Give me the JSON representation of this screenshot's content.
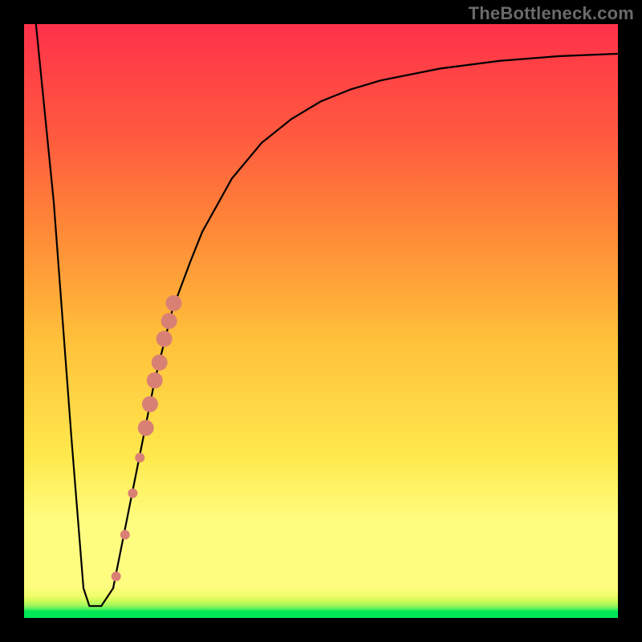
{
  "watermark": "TheBottleneck.com",
  "chart_data": {
    "type": "line",
    "title": "",
    "xlabel": "",
    "ylabel": "",
    "xlim": [
      0,
      100
    ],
    "ylim": [
      0,
      100
    ],
    "series": [
      {
        "name": "bottleneck-curve",
        "x": [
          2,
          5,
          8,
          10,
          11,
          12,
          13,
          15,
          18,
          20,
          22,
          25,
          28,
          30,
          35,
          40,
          45,
          50,
          55,
          60,
          70,
          80,
          90,
          100
        ],
        "y": [
          100,
          70,
          30,
          5,
          2,
          2,
          2,
          5,
          20,
          30,
          40,
          52,
          60,
          65,
          74,
          80,
          84,
          87,
          89,
          90.5,
          92.5,
          93.8,
          94.6,
          95
        ]
      }
    ],
    "markers": {
      "name": "highlighted-points",
      "color": "#d98075",
      "points": [
        {
          "x": 15.5,
          "y": 7,
          "r": 6
        },
        {
          "x": 17.0,
          "y": 14,
          "r": 6
        },
        {
          "x": 18.3,
          "y": 21,
          "r": 6
        },
        {
          "x": 19.5,
          "y": 27,
          "r": 6
        },
        {
          "x": 20.5,
          "y": 32,
          "r": 10
        },
        {
          "x": 21.2,
          "y": 36,
          "r": 10
        },
        {
          "x": 22.0,
          "y": 40,
          "r": 10
        },
        {
          "x": 22.8,
          "y": 43,
          "r": 10
        },
        {
          "x": 23.6,
          "y": 47,
          "r": 10
        },
        {
          "x": 24.4,
          "y": 50,
          "r": 10
        },
        {
          "x": 25.2,
          "y": 53,
          "r": 10
        }
      ]
    },
    "background_gradient": {
      "bottom": "#00e756",
      "lower_mid": "#fffd80",
      "upper_mid": "#ff8a37",
      "top": "#ff314a"
    }
  }
}
